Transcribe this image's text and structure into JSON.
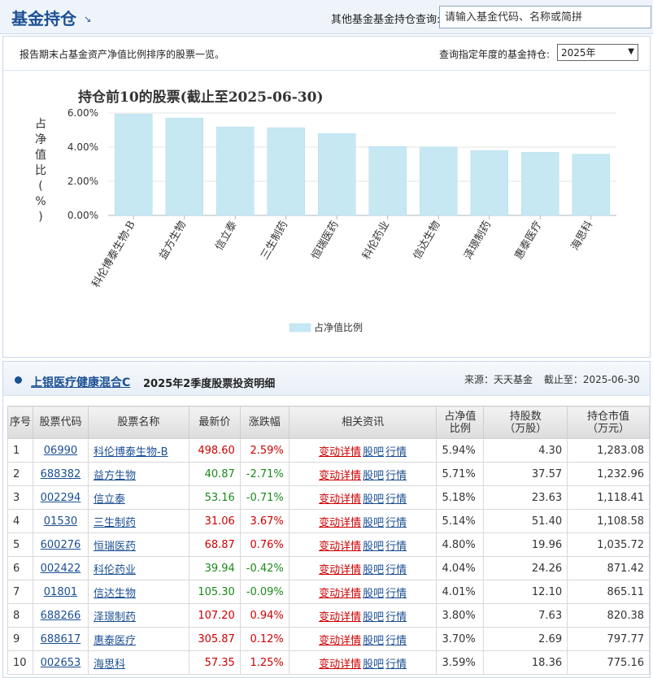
{
  "header": {
    "title": "基金持仓",
    "search_label": "其他基金基金持仓查询:",
    "search_placeholder": "请输入基金代码、名称或简拼"
  },
  "info_bar": {
    "text": "报告期末占基金资产净值比例排序的股票一览。",
    "year_label": "查询指定年度的基金持仓:",
    "year_selected": "2025年"
  },
  "chart_data": {
    "type": "bar",
    "title": "持仓前10的股票(截止至2025-06-30)",
    "ylabel": "占净值比(%)",
    "categories": [
      "科伦博泰生物-B",
      "益方生物",
      "信立泰",
      "三生制药",
      "恒瑞医药",
      "科伦药业",
      "信达生物",
      "泽璟制药",
      "惠泰医疗",
      "海思科"
    ],
    "series": [
      {
        "name": "占净值比例",
        "values": [
          5.94,
          5.71,
          5.18,
          5.14,
          4.8,
          4.04,
          4.01,
          3.8,
          3.7,
          3.59
        ]
      }
    ],
    "ylim": [
      0,
      6
    ],
    "yticks": [
      "0.00%",
      "2.00%",
      "4.00%",
      "6.00%"
    ],
    "grid": true,
    "legend": "bottom-center",
    "bar_color": "#c6e8f3"
  },
  "table_section": {
    "fund_name": "上银医疗健康混合C",
    "detail_title": "2025年2季度股票投资明细",
    "source": "来源：天天基金",
    "as_of": "截止至：2025-06-30",
    "columns": [
      "序号",
      "股票代码",
      "股票名称",
      "最新价",
      "涨跌幅",
      "相关资讯",
      "占净值比例",
      "持股数（万股）",
      "持仓市值（万元）"
    ],
    "col_pct_l1": "占净值",
    "col_pct_l2": "比例",
    "col_shares_l1": "持股数",
    "col_shares_l2": "（万股）",
    "col_value_l1": "持仓市值",
    "col_value_l2": "（万元）",
    "link_labels": {
      "change": "变动详情",
      "forum": "股吧",
      "quote": "行情"
    },
    "rows": [
      {
        "idx": "1",
        "code": "06990",
        "name": "科伦博泰生物-B",
        "price": "498.60",
        "change": "2.59%",
        "dir": "up",
        "pct": "5.94%",
        "shares": "4.30",
        "value": "1,283.08"
      },
      {
        "idx": "2",
        "code": "688382",
        "name": "益方生物",
        "price": "40.87",
        "change": "-2.71%",
        "dir": "down",
        "pct": "5.71%",
        "shares": "37.57",
        "value": "1,232.96"
      },
      {
        "idx": "3",
        "code": "002294",
        "name": "信立泰",
        "price": "53.16",
        "change": "-0.71%",
        "dir": "down",
        "pct": "5.18%",
        "shares": "23.63",
        "value": "1,118.41"
      },
      {
        "idx": "4",
        "code": "01530",
        "name": "三生制药",
        "price": "31.06",
        "change": "3.67%",
        "dir": "up",
        "pct": "5.14%",
        "shares": "51.40",
        "value": "1,108.58"
      },
      {
        "idx": "5",
        "code": "600276",
        "name": "恒瑞医药",
        "price": "68.87",
        "change": "0.76%",
        "dir": "up",
        "pct": "4.80%",
        "shares": "19.96",
        "value": "1,035.72"
      },
      {
        "idx": "6",
        "code": "002422",
        "name": "科伦药业",
        "price": "39.94",
        "change": "-0.42%",
        "dir": "down",
        "pct": "4.04%",
        "shares": "24.26",
        "value": "871.42"
      },
      {
        "idx": "7",
        "code": "01801",
        "name": "信达生物",
        "price": "105.30",
        "change": "-0.09%",
        "dir": "down",
        "pct": "4.01%",
        "shares": "12.10",
        "value": "865.11"
      },
      {
        "idx": "8",
        "code": "688266",
        "name": "泽璟制药",
        "price": "107.20",
        "change": "0.94%",
        "dir": "up",
        "pct": "3.80%",
        "shares": "7.63",
        "value": "820.38"
      },
      {
        "idx": "9",
        "code": "688617",
        "name": "惠泰医疗",
        "price": "305.87",
        "change": "0.12%",
        "dir": "up",
        "pct": "3.70%",
        "shares": "2.69",
        "value": "797.77"
      },
      {
        "idx": "10",
        "code": "002653",
        "name": "海思科",
        "price": "57.35",
        "change": "1.25%",
        "dir": "up",
        "pct": "3.59%",
        "shares": "18.36",
        "value": "775.16"
      }
    ]
  }
}
